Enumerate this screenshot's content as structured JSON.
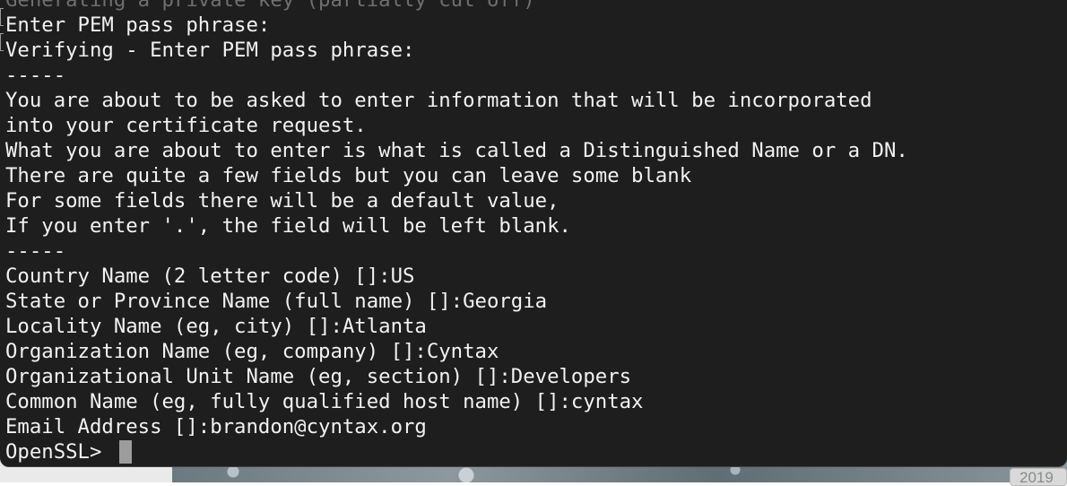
{
  "terminal": {
    "lines": [
      "Generating a private key (partially cut off)",
      "Enter PEM pass phrase:",
      "Verifying - Enter PEM pass phrase:",
      "-----",
      "You are about to be asked to enter information that will be incorporated",
      "into your certificate request.",
      "What you are about to enter is what is called a Distinguished Name or a DN.",
      "There are quite a few fields but you can leave some blank",
      "For some fields there will be a default value,",
      "If you enter '.', the field will be left blank.",
      "-----",
      "Country Name (2 letter code) []:US",
      "State or Province Name (full name) []:Georgia",
      "Locality Name (eg, city) []:Atlanta",
      "Organization Name (eg, company) []:Cyntax",
      "Organizational Unit Name (eg, section) []:Developers",
      "Common Name (eg, fully qualified host name) []:cyntax",
      "Email Address []:brandon@cyntax.org"
    ],
    "prompt": "OpenSSL> "
  },
  "desktop": {
    "date_badge": "2019"
  },
  "colors": {
    "terminal_bg": "#1e1e1e",
    "text": "#f2f2f2",
    "cursor": "#9c9c9c"
  }
}
